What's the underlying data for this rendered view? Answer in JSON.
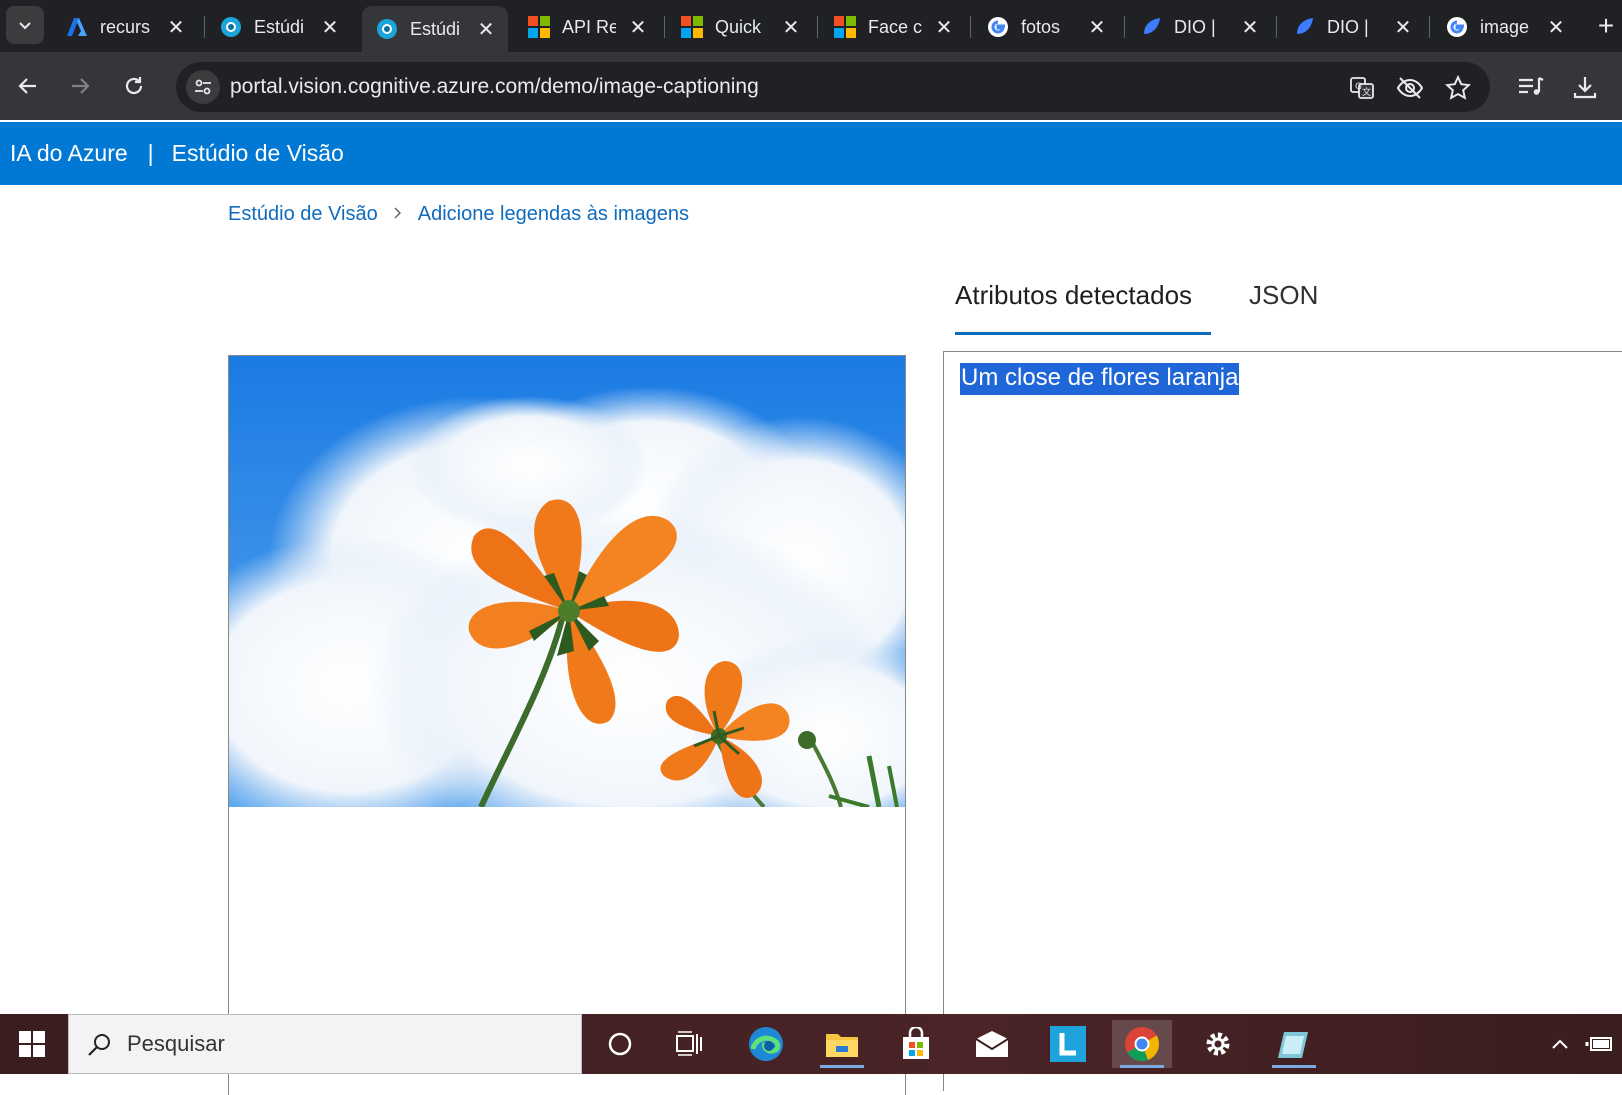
{
  "browser": {
    "tabs": [
      {
        "title": "recurs",
        "icon": "azure-logo-icon"
      },
      {
        "title": "Estúdi",
        "icon": "vision-studio-icon"
      },
      {
        "title": "Estúdi",
        "icon": "vision-studio-icon",
        "active": true
      },
      {
        "title": "API Re",
        "icon": "microsoft-logo-icon"
      },
      {
        "title": "Quick",
        "icon": "microsoft-logo-icon"
      },
      {
        "title": "Face c",
        "icon": "microsoft-logo-icon"
      },
      {
        "title": "fotos",
        "icon": "google-logo-icon"
      },
      {
        "title": "DIO |",
        "icon": "dio-logo-icon"
      },
      {
        "title": "DIO |",
        "icon": "dio-logo-icon"
      },
      {
        "title": "image",
        "icon": "google-logo-icon"
      }
    ],
    "url": "portal.vision.cognitive.azure.com/demo/image-captioning"
  },
  "header": {
    "brand": "IA do Azure",
    "separator": "|",
    "product": "Estúdio de Visão"
  },
  "breadcrumb": {
    "items": [
      "Estúdio de Visão",
      "Adicione legendas às imagens"
    ]
  },
  "results": {
    "tabs": [
      "Atributos detectados",
      "JSON"
    ],
    "caption": "Um close de flores laranja"
  },
  "taskbar": {
    "search_placeholder": "Pesquisar"
  },
  "colors": {
    "azure_blue": "#0078d4",
    "link_blue": "#0f6cbd",
    "selection_blue": "#1f66d8",
    "browser_dark": "#202124"
  }
}
